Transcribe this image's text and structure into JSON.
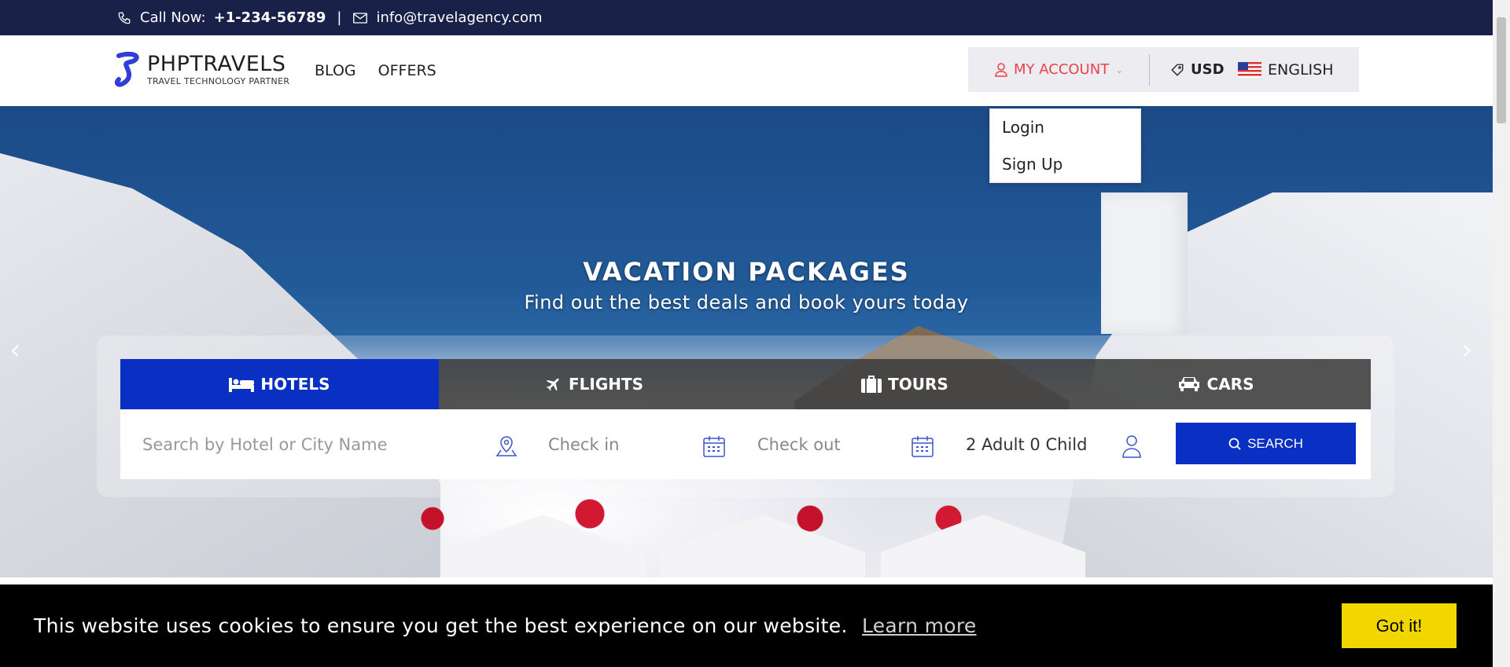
{
  "topbar": {
    "call_label": "Call Now:",
    "phone": "+1-234-56789",
    "separator": "|",
    "email": "info@travelagency.com"
  },
  "header": {
    "logo_title": "PHPTRAVELS",
    "logo_subtitle": "TRAVEL TECHNOLOGY PARTNER",
    "nav": [
      "BLOG",
      "OFFERS"
    ],
    "account_label": "MY ACCOUNT",
    "currency": "USD",
    "language": "ENGLISH"
  },
  "account_dropdown": [
    "Login",
    "Sign Up"
  ],
  "hero": {
    "title": "VACATION PACKAGES",
    "subtitle": "Find out the best deals and book yours today"
  },
  "tabs": [
    {
      "label": "HOTELS",
      "icon": "bed-icon",
      "active": true
    },
    {
      "label": "FLIGHTS",
      "icon": "plane-icon",
      "active": false
    },
    {
      "label": "TOURS",
      "icon": "suitcase-icon",
      "active": false
    },
    {
      "label": "CARS",
      "icon": "car-icon",
      "active": false
    }
  ],
  "search": {
    "hotel_placeholder": "Search by Hotel or City Name",
    "checkin_placeholder": "Check in",
    "checkout_placeholder": "Check out",
    "guests": "2 Adult 0 Child",
    "button_label": "SEARCH"
  },
  "cookie": {
    "message": "This website uses cookies to ensure you get the best experience on our website.",
    "learn_more": "Learn more",
    "accept": "Got it!"
  },
  "colors": {
    "topbar": "#1a2149",
    "primary": "#0a2fc3",
    "account": "#e8424d",
    "cookie_button": "#f1d600"
  }
}
